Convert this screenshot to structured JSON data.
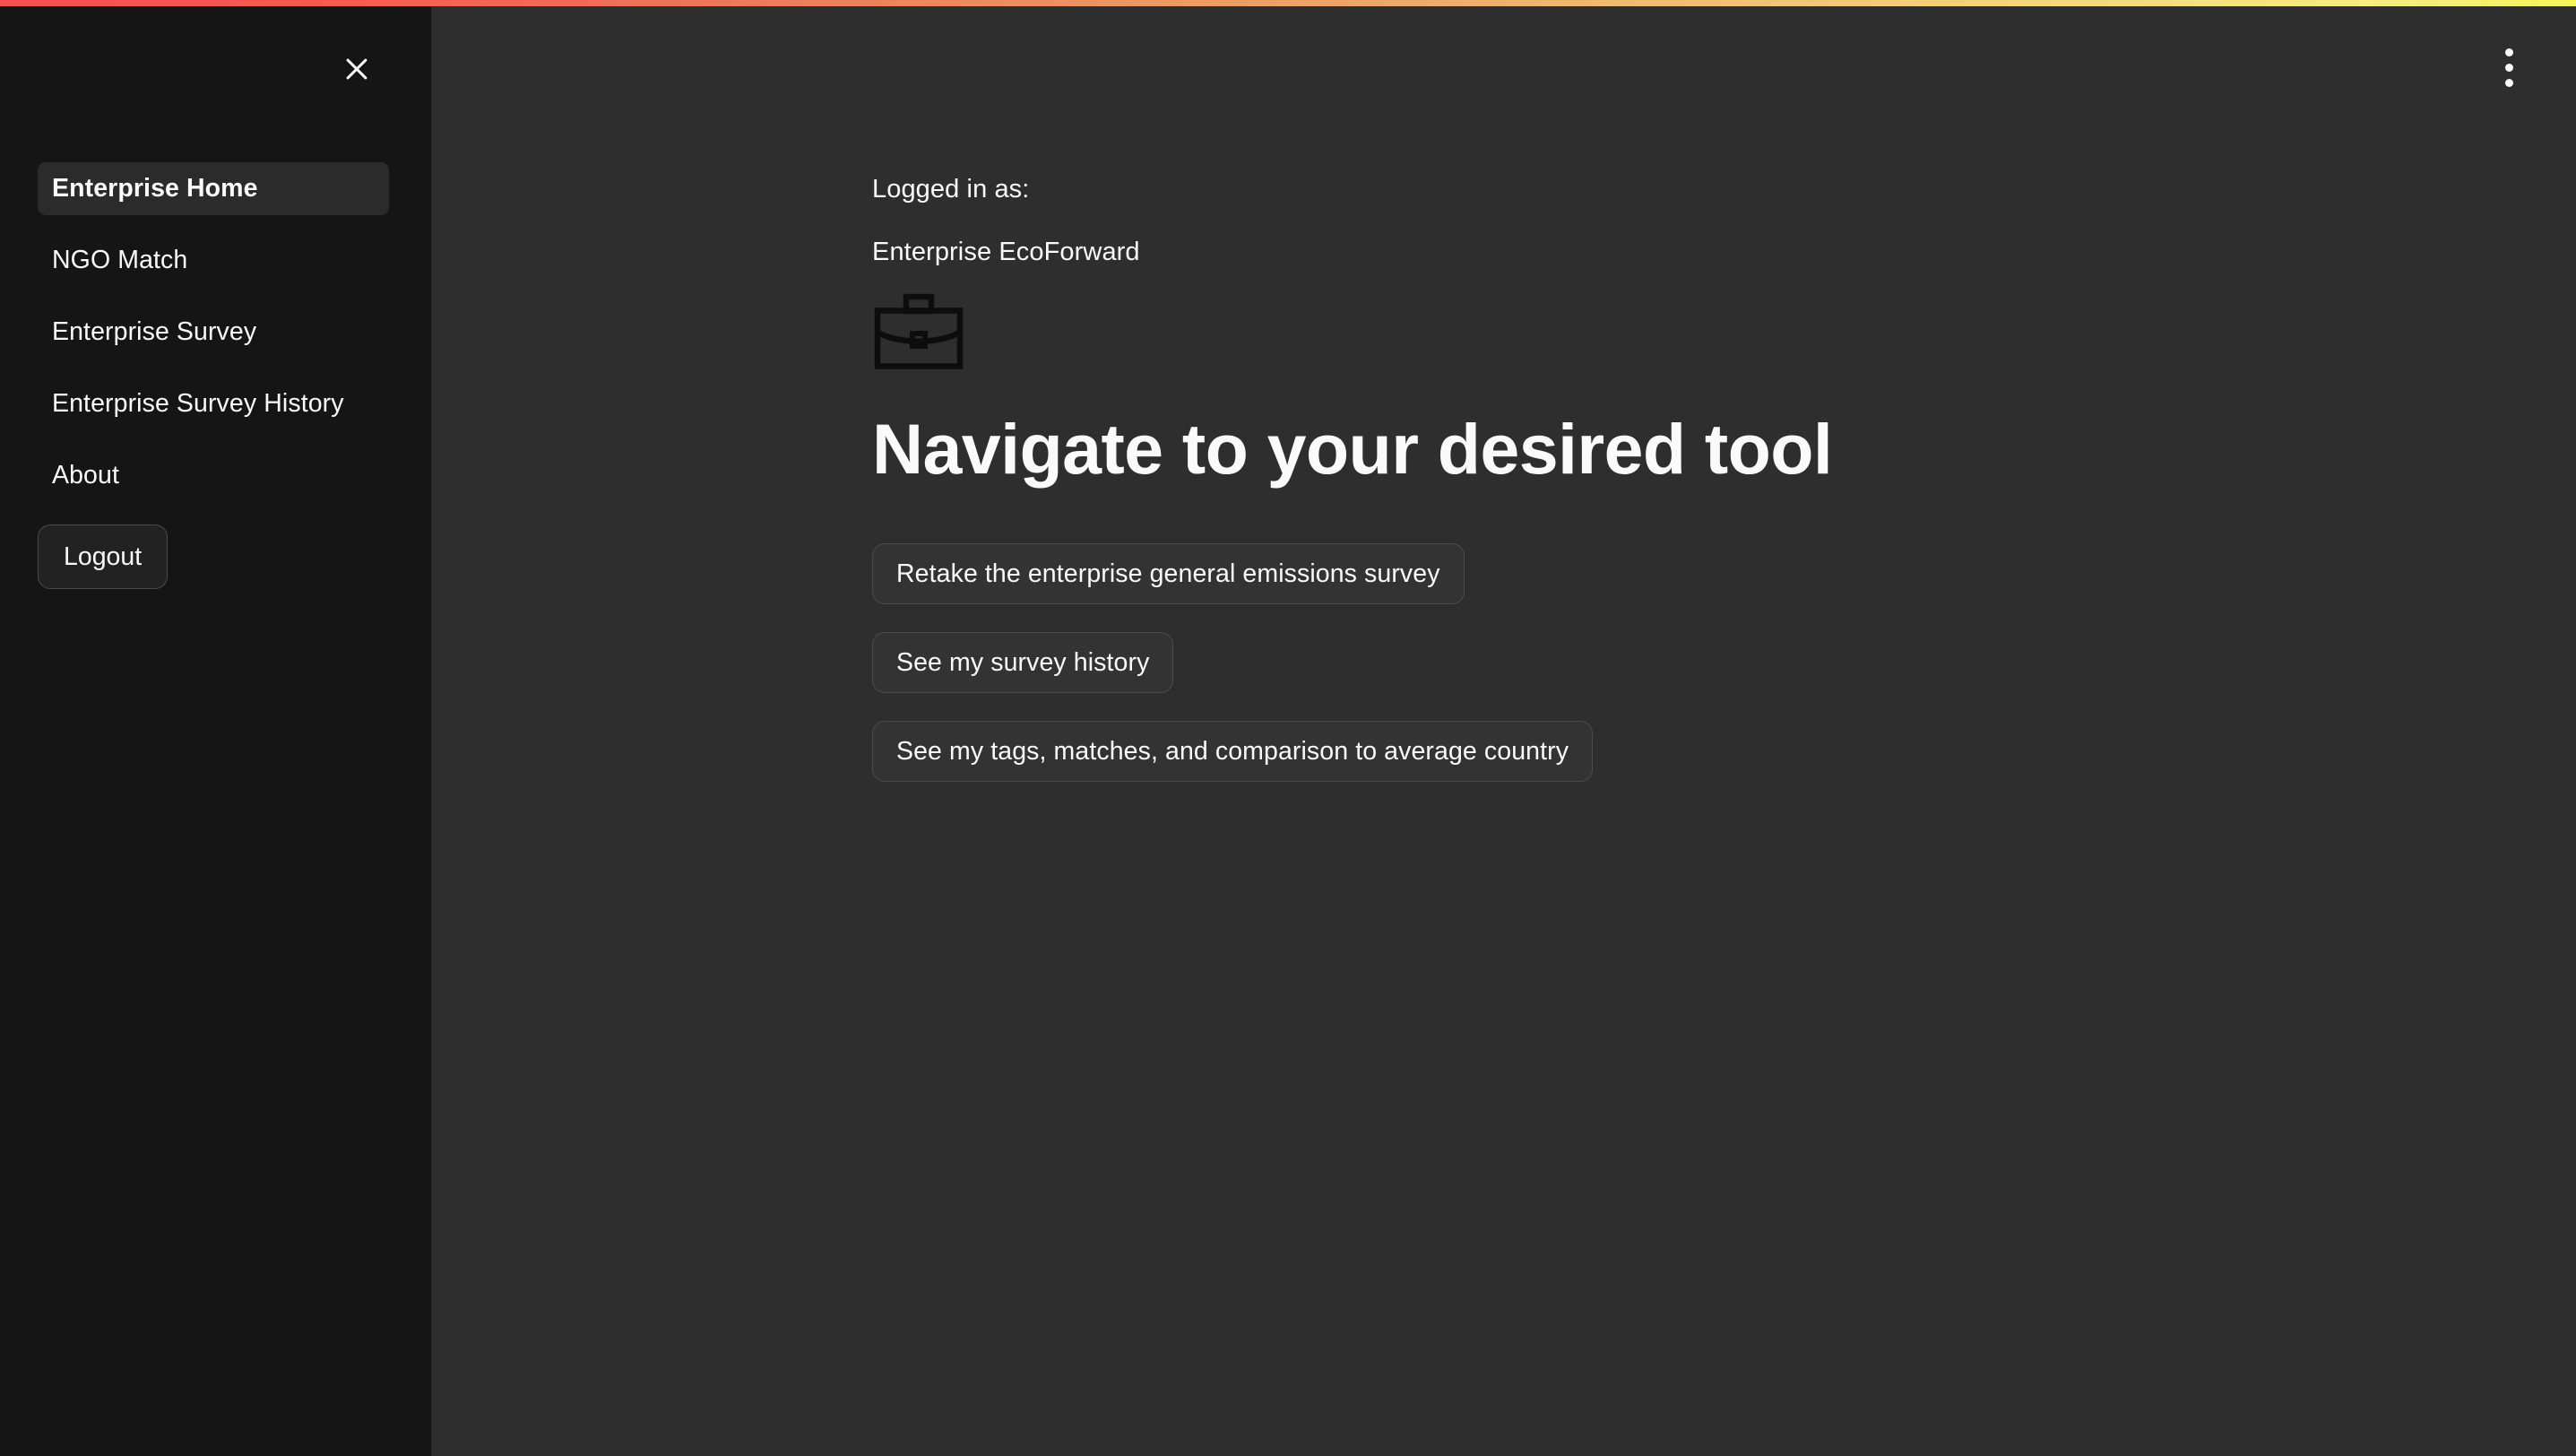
{
  "theme": {
    "sidebar_bg": "#151515",
    "main_bg": "#2e2e2e",
    "text_color": "#fafafa",
    "active_item_bg": "#2b2b2b",
    "button_bg": "#333333",
    "button_border": "#4b4b4b",
    "gradient_start": "#f5534e",
    "gradient_mid": "#f0a464",
    "gradient_end": "#f4f45e"
  },
  "top_bar": {
    "name": "gradient-decoration-bar"
  },
  "sidebar": {
    "close_icon": "close-icon",
    "items": [
      {
        "label": "Enterprise Home",
        "active": true
      },
      {
        "label": "NGO Match",
        "active": false
      },
      {
        "label": "Enterprise Survey",
        "active": false
      },
      {
        "label": "Enterprise Survey History",
        "active": false
      },
      {
        "label": "About",
        "active": false
      }
    ],
    "logout_label": "Logout"
  },
  "header": {
    "kebab_icon": "more-options-icon"
  },
  "main": {
    "logged_in_label": "Logged in as:",
    "enterprise_name": "Enterprise EcoForward",
    "avatar_icon": "briefcase-icon",
    "title": "Navigate to your desired tool",
    "actions": [
      {
        "label": "Retake the enterprise general emissions survey"
      },
      {
        "label": "See my survey history"
      },
      {
        "label": "See my tags, matches, and comparison to average country"
      }
    ]
  }
}
